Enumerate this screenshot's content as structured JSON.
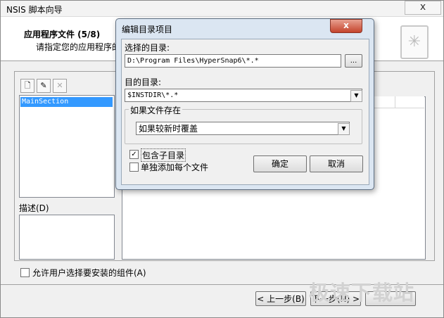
{
  "window": {
    "title": "NSIS 脚本向导",
    "close_glyph": "x"
  },
  "header": {
    "title": "应用程序文件 (5/8)",
    "subtitle": "请指定您的应用程序的",
    "icon": "document-icon"
  },
  "sections": {
    "selected": "MainSection"
  },
  "toolbar": {
    "new_icon": "new-page-icon",
    "edit_icon": "edit-icon",
    "delete_icon": "delete-x-icon"
  },
  "description": {
    "label": "描述(D)"
  },
  "options": {
    "allow_select": "允许用户选择要安装的组件(A)",
    "allow_select_checked": false
  },
  "nav": {
    "back": "< 上一步(B)",
    "next": "下一步(N) >"
  },
  "watermark": "极速下载站",
  "dialog": {
    "title": "编辑目录项目",
    "close_glyph": "x",
    "source_label": "选择的目录:",
    "source_value": "D:\\Program Files\\HyperSnap6\\*.*",
    "browse_label": "...",
    "target_label": "目的目录:",
    "target_value": "$INSTDIR\\*.*",
    "exists_group": "如果文件存在",
    "exists_value": "如果较新时覆盖",
    "include_sub": "包含子目录",
    "include_sub_checked": true,
    "add_each": "单独添加每个文件",
    "add_each_checked": false,
    "ok": "确定",
    "cancel": "取消"
  },
  "colors": {
    "selection": "#3399ff",
    "close_red": "#c4442c",
    "dialog_frame": "#dbe6f2"
  }
}
